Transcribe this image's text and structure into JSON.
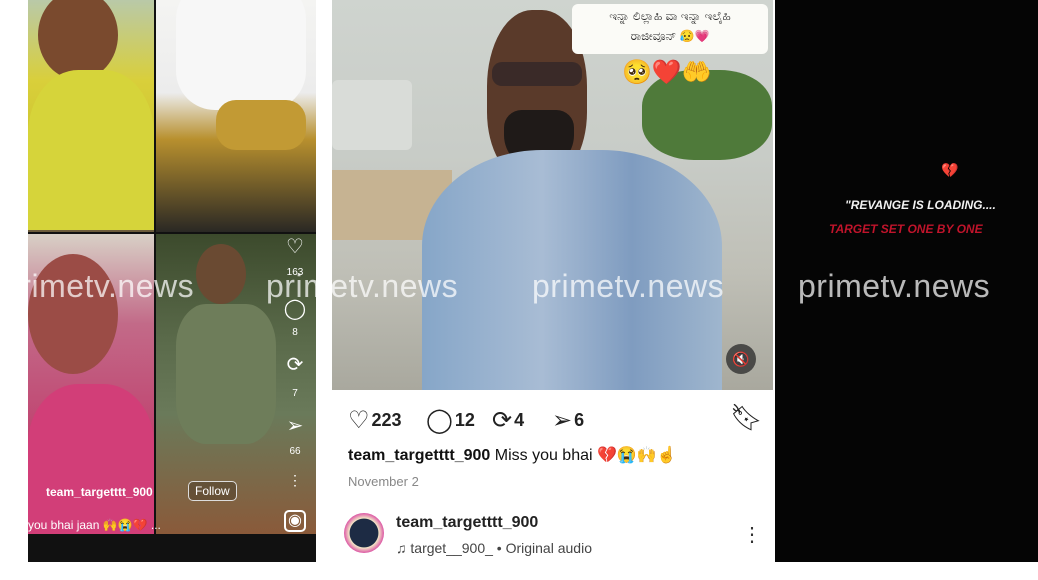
{
  "left_reel": {
    "likes": "163",
    "comments": "8",
    "reposts": "7",
    "shares": "66",
    "username": "team_targetttt_900",
    "follow_label": "Follow",
    "caption": "you bhai jaan 🙌😭💔 ..."
  },
  "post": {
    "sticker_line1": "ಇನ್ನಾ ಲಿಲ್ಲಾಹಿ ವಾ ಇನ್ನಾ ಇಲೈಹಿ",
    "sticker_line2": "ರಾಜೀವೂನ್ 😥💗",
    "actions": {
      "likes": "223",
      "comments": "12",
      "reposts": "4",
      "shares": "6"
    },
    "caption_user": "team_targetttt_900",
    "caption_text": "Miss you  bhai 💔😭🙌☝",
    "date": "November 2",
    "account_name": "team_targetttt_900",
    "audio": "target__900_ • Original audio"
  },
  "right_panel": {
    "title": "\"REVANGE IS LOADING....",
    "subtitle": "TARGET SET ONE BY ONE"
  },
  "watermark": "primetv.news",
  "icons": [
    "heart-icon",
    "comment-icon",
    "repost-icon",
    "share-icon",
    "bookmark-icon",
    "mute-icon",
    "music-icon",
    "more-icon"
  ]
}
